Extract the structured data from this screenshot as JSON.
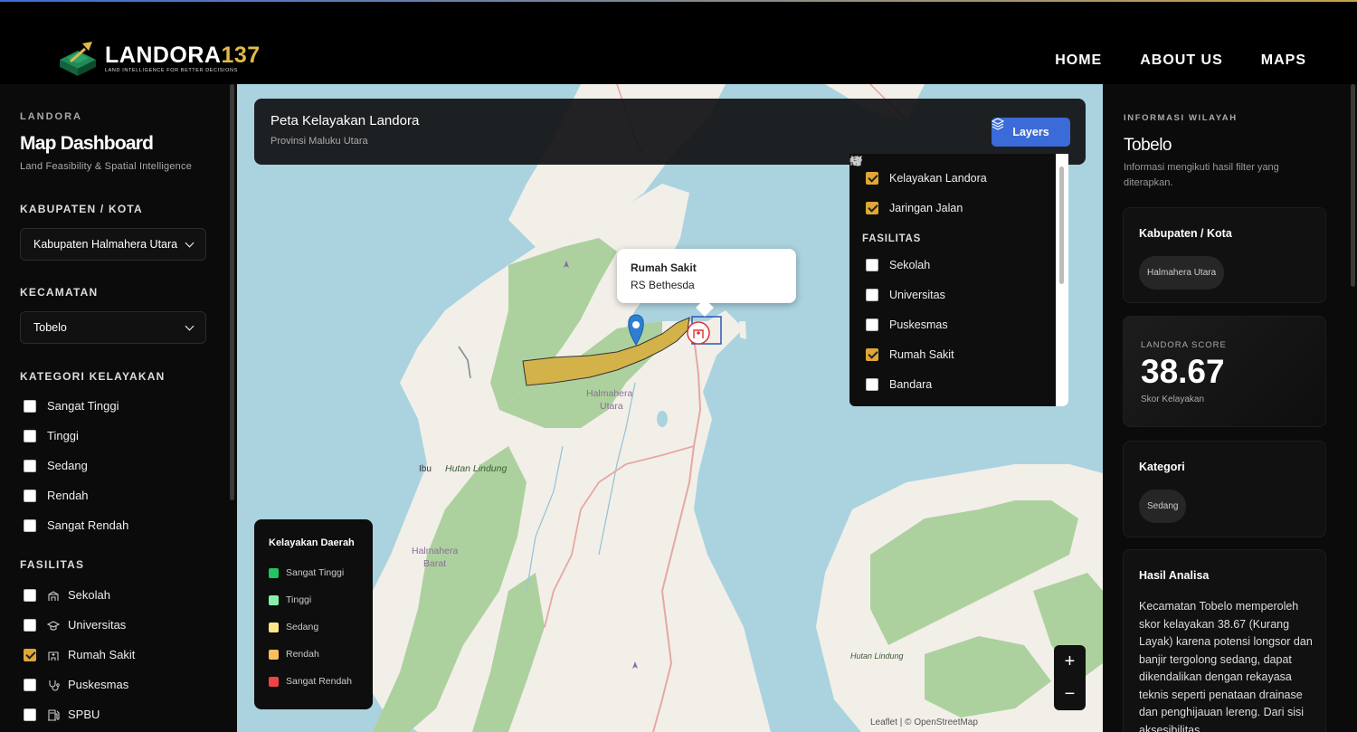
{
  "brand": {
    "name_main": "LANDORA",
    "name_num": "137",
    "tagline": "LAND INTELLIGENCE FOR BETTER DECISIONS"
  },
  "nav": {
    "home": "HOME",
    "about": "ABOUT US",
    "maps": "MAPS"
  },
  "sidebar": {
    "eyebrow": "LANDORA",
    "title": "Map Dashboard",
    "subtitle": "Land Feasibility & Spatial Intelligence",
    "kabupaten_label": "KABUPATEN / KOTA",
    "kabupaten_value": "Kabupaten Halmahera Utara",
    "kecamatan_label": "KECAMATAN",
    "kecamatan_value": "Tobelo",
    "kategori_label": "KATEGORI KELAYAKAN",
    "kategori": [
      {
        "label": "Sangat Tinggi",
        "checked": false
      },
      {
        "label": "Tinggi",
        "checked": false
      },
      {
        "label": "Sedang",
        "checked": false
      },
      {
        "label": "Rendah",
        "checked": false
      },
      {
        "label": "Sangat Rendah",
        "checked": false
      }
    ],
    "fasilitas_label": "FASILITAS",
    "fasilitas": [
      {
        "label": "Sekolah",
        "icon": "school-icon",
        "checked": false
      },
      {
        "label": "Universitas",
        "icon": "graduation-cap-icon",
        "checked": false
      },
      {
        "label": "Rumah Sakit",
        "icon": "hospital-icon",
        "checked": true
      },
      {
        "label": "Puskesmas",
        "icon": "stethoscope-icon",
        "checked": false
      },
      {
        "label": "SPBU",
        "icon": "fuel-pump-icon",
        "checked": false
      }
    ]
  },
  "map": {
    "title": "Peta Kelayakan Landora",
    "subtitle": "Provinsi Maluku Utara",
    "layers_button": "Layers",
    "labels": {
      "halmahera_utara_1": "Halmahera",
      "halmahera_utara_2": "Utara",
      "ibu": "Ibu",
      "hutan_lindung": "Hutan Lindung",
      "halmahera_barat_1": "Halmahera",
      "halmahera_barat_2": "Barat",
      "hutan_lindung_2": "Hutan Lindung"
    },
    "layers_panel": {
      "layers": [
        {
          "label": "Kelayakan Landora",
          "checked": true
        },
        {
          "label": "Jaringan Jalan",
          "checked": true
        }
      ],
      "fasilitas_label": "FASILITAS",
      "fasilitas": [
        {
          "label": "Sekolah",
          "checked": false
        },
        {
          "label": "Universitas",
          "checked": false
        },
        {
          "label": "Puskesmas",
          "checked": false
        },
        {
          "label": "Rumah Sakit",
          "checked": true
        },
        {
          "label": "Bandara",
          "checked": false
        }
      ]
    },
    "popup": {
      "title": "Rumah Sakit",
      "name": "RS Bethesda"
    },
    "legend": {
      "title": "Kelayakan Daerah",
      "items": [
        {
          "label": "Sangat Tinggi",
          "color": "#22c55e"
        },
        {
          "label": "Tinggi",
          "color": "#86efac"
        },
        {
          "label": "Sedang",
          "color": "#fde68a"
        },
        {
          "label": "Rendah",
          "color": "#fbbf5f"
        },
        {
          "label": "Sangat Rendah",
          "color": "#ef4444"
        }
      ]
    },
    "zoom_in": "+",
    "zoom_out": "−",
    "attribution": "Leaflet | © OpenStreetMap"
  },
  "info": {
    "eyebrow": "INFORMASI WILAYAH",
    "title": "Tobelo",
    "subtitle": "Informasi mengikuti hasil filter yang diterapkan.",
    "kabupaten_label": "Kabupaten / Kota",
    "kabupaten_chip": "Halmahera Utara",
    "score_label": "LANDORA SCORE",
    "score_value": "38.67",
    "score_sub": "Skor Kelayakan",
    "kategori_label": "Kategori",
    "kategori_chip": "Sedang",
    "analisa_label": "Hasil Analisa",
    "analisa_text": "Kecamatan Tobelo memperoleh skor kelayakan 38.67 (Kurang Layak) karena potensi longsor dan banjir tergolong sedang, dapat dikendalikan dengan rekayasa teknis seperti penataan drainase dan penghijauan lereng. Dari sisi aksesibilitas"
  }
}
